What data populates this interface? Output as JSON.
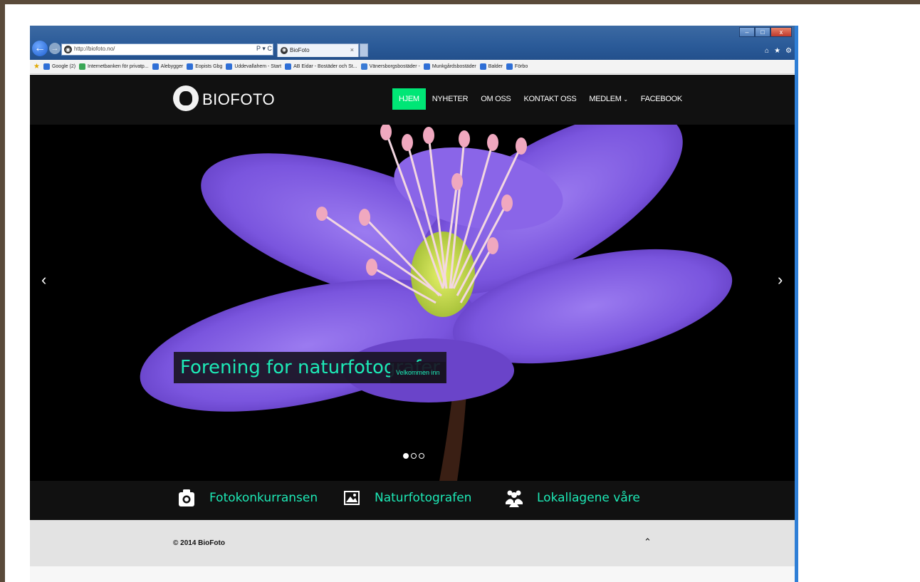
{
  "browser": {
    "address": "http://biofoto.no/",
    "tab_title": "BioFoto",
    "tab_close": "×",
    "addr_tools": "P ▾ C",
    "back": "←",
    "forward": "→",
    "tools": [
      "⌂",
      "★",
      "⚙"
    ],
    "window_controls": [
      "–",
      "□",
      "x"
    ]
  },
  "favorites": [
    {
      "label": "Google (2)",
      "color": "#2f6fd6"
    },
    {
      "label": "Internetbanken för privatp...",
      "color": "#3aa655"
    },
    {
      "label": "Alebygger",
      "color": "#2f6fd6"
    },
    {
      "label": "Eopists Gbg",
      "color": "#2f6fd6"
    },
    {
      "label": "Uddevallahem - Start",
      "color": "#2f6fd6"
    },
    {
      "label": "AB Eidar - Bostäder och St...",
      "color": "#2f6fd6"
    },
    {
      "label": "Vänersborgsbostäder -",
      "color": "#3a7bd5"
    },
    {
      "label": "Munkgårdsbostäder",
      "color": "#2f6fd6"
    },
    {
      "label": "Balder",
      "color": "#2f6fd6"
    },
    {
      "label": "Förbo",
      "color": "#2f6fd6"
    }
  ],
  "site": {
    "logo_text": "BIOFOTO",
    "nav": [
      {
        "label": "HJEM",
        "active": true
      },
      {
        "label": "NYHETER",
        "active": false
      },
      {
        "label": "OM OSS",
        "active": false
      },
      {
        "label": "KONTAKT OSS",
        "active": false
      },
      {
        "label": "MEDLEM",
        "active": false,
        "dropdown": true
      },
      {
        "label": "FACEBOOK",
        "active": false
      }
    ],
    "hero": {
      "title": "Forening for naturfotografer",
      "subtitle": "Velkommen inn",
      "prev": "‹",
      "next": "›",
      "slide_count": 3,
      "active_slide": 1
    },
    "features": [
      {
        "label": "Fotokonkurransen",
        "icon": "camera-icon"
      },
      {
        "label": "Naturfotografen",
        "icon": "picture-icon"
      },
      {
        "label": "Lokallagene våre",
        "icon": "users-icon"
      }
    ],
    "footer": {
      "copyright": "© 2014 BioFoto",
      "to_top": "⌃"
    }
  },
  "colors": {
    "accent": "#00e676",
    "caption_text": "#1de9b6",
    "header_bg": "#111111",
    "footer_bg": "#e3e3e3"
  }
}
